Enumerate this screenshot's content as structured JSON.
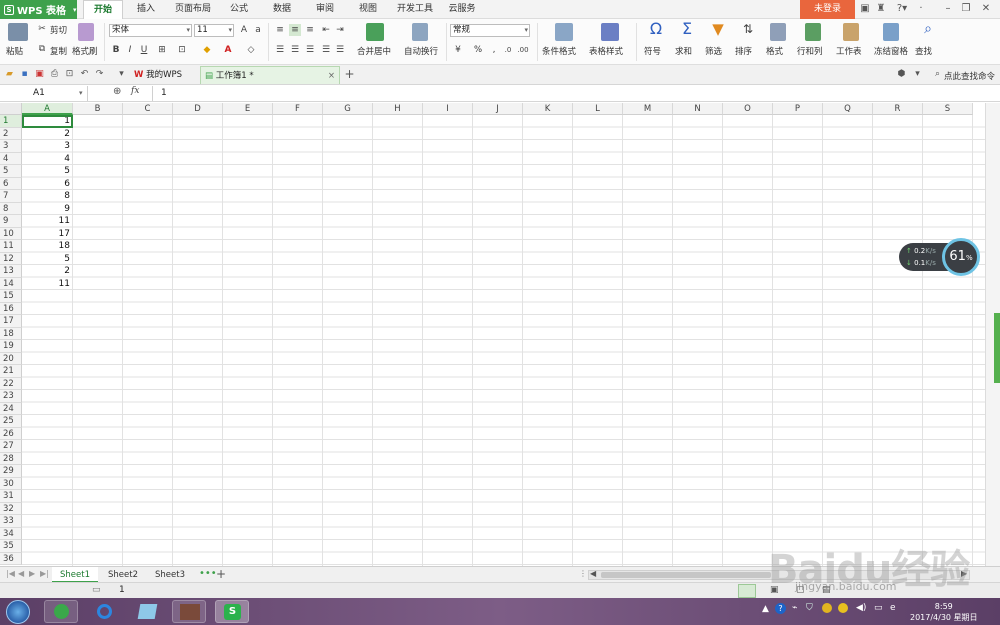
{
  "app": {
    "name": "WPS 表格",
    "login": "未登录"
  },
  "menu_tabs": [
    "开始",
    "插入",
    "页面布局",
    "公式",
    "数据",
    "审阅",
    "视图",
    "开发工具",
    "云服务"
  ],
  "ribbon": {
    "paste": "粘贴",
    "cut": "剪切",
    "copy": "复制",
    "format_painter": "格式刷",
    "font_name": "宋体",
    "font_size": "11",
    "merge_center": "合并居中",
    "wrap_text": "自动换行",
    "number_format": "常规",
    "percent": "%",
    "conditional_format": "条件格式",
    "table_style": "表格样式",
    "symbol": "符号",
    "sum": "求和",
    "filter": "筛选",
    "sort": "排序",
    "format": "格式",
    "rows_cols": "行和列",
    "worksheet": "工作表",
    "freeze": "冻结窗格",
    "find": "查找"
  },
  "doc_tabs": {
    "my_wps": "我的WPS",
    "workbook": "工作簿1 *",
    "search_hint": "点此查找命令"
  },
  "formula_bar": {
    "cell_ref": "A1",
    "fx": "fx",
    "value": "1"
  },
  "columns": [
    "A",
    "B",
    "C",
    "D",
    "E",
    "F",
    "G",
    "H",
    "I",
    "J",
    "K",
    "L",
    "M",
    "N",
    "O",
    "P",
    "Q",
    "R",
    "S"
  ],
  "rows": [
    "1",
    "2",
    "3",
    "4",
    "5",
    "6",
    "7",
    "8",
    "9",
    "10",
    "11",
    "12",
    "13",
    "14",
    "15",
    "16",
    "17",
    "18",
    "19",
    "20",
    "21",
    "22",
    "23",
    "24",
    "25",
    "26",
    "27",
    "28",
    "29",
    "30",
    "31",
    "32",
    "33",
    "34",
    "35",
    "36"
  ],
  "column_a_values": [
    "1",
    "2",
    "3",
    "4",
    "5",
    "6",
    "8",
    "9",
    "11",
    "17",
    "18",
    "5",
    "2",
    "11"
  ],
  "sheets": [
    "Sheet1",
    "Sheet2",
    "Sheet3"
  ],
  "status": {
    "page": "1"
  },
  "speed_widget": {
    "up": "0.2",
    "down": "0.1",
    "unit": "K/s",
    "percent": "61",
    "percent_sign": "%"
  },
  "clock": {
    "time": "8:59",
    "date": "2017/4/30 星期日"
  },
  "watermark": {
    "text": "Baidu经验",
    "sub": "jingyan.baidu.com"
  },
  "colors": {
    "accent": "#3ea14b",
    "login": "#e9663d",
    "selection": "#2e8b3d"
  }
}
